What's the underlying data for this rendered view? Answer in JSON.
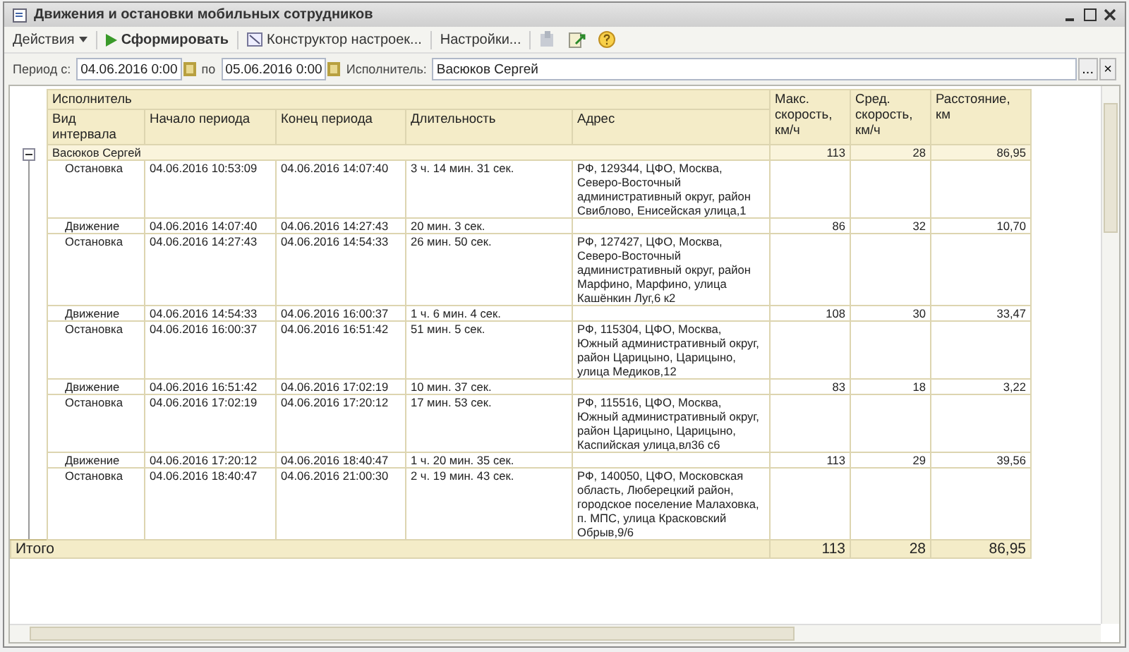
{
  "window": {
    "title": "Движения и остановки мобильных сотрудников"
  },
  "toolbar": [
    {
      "kind": "menu",
      "label": "Действия"
    },
    {
      "kind": "run",
      "label": "Сформировать"
    },
    {
      "kind": "designer",
      "label": "Конструктор настроек..."
    },
    {
      "kind": "plain",
      "label": "Настройки..."
    },
    {
      "kind": "icon-disabled"
    },
    {
      "kind": "icon-export"
    },
    {
      "kind": "icon-help"
    }
  ],
  "filters": {
    "period_label": "Период с:",
    "period_from": "04.06.2016  0:00",
    "to_label": "по",
    "period_to": "05.06.2016  0:00",
    "executor_label": "Исполнитель:",
    "executor": "Васюков Сергей",
    "choose_button": "...",
    "clear_button": "×"
  },
  "table": {
    "group_header": "Исполнитель",
    "columns": [
      "Вид интервала",
      "Начало периода",
      "Конец периода",
      "Длительность",
      "Адрес",
      "Макс. скорость, км/ч",
      "Сред. скорость, км/ч",
      "Расстояние, км"
    ],
    "groups": [
      {
        "name": "Васюков Сергей",
        "expanded": true,
        "max_speed": "113",
        "avg_speed": "28",
        "distance": "86,95",
        "rows": [
          {
            "type": "Остановка",
            "start": "04.06.2016 10:53:09",
            "end": "04.06.2016 14:07:40",
            "duration": "3 ч. 14 мин. 31 сек.",
            "address": "РФ, 129344, ЦФО, Москва, Северо-Восточный административный округ, район Свиблово, Енисейская улица,1"
          },
          {
            "type": "Движение",
            "start": "04.06.2016 14:07:40",
            "end": "04.06.2016 14:27:43",
            "duration": "20 мин. 3 сек.",
            "max_speed": "86",
            "avg_speed": "32",
            "distance": "10,70"
          },
          {
            "type": "Остановка",
            "start": "04.06.2016 14:27:43",
            "end": "04.06.2016 14:54:33",
            "duration": "26 мин. 50 сек.",
            "address": "РФ, 127427, ЦФО, Москва, Северо-Восточный административный округ, район Марфино, Марфино, улица Кашёнкин Луг,6 к2"
          },
          {
            "type": "Движение",
            "start": "04.06.2016 14:54:33",
            "end": "04.06.2016 16:00:37",
            "duration": "1 ч. 6 мин. 4 сек.",
            "max_speed": "108",
            "avg_speed": "30",
            "distance": "33,47"
          },
          {
            "type": "Остановка",
            "start": "04.06.2016 16:00:37",
            "end": "04.06.2016 16:51:42",
            "duration": "51 мин. 5 сек.",
            "address": "РФ, 115304, ЦФО, Москва, Южный административный округ, район Царицыно, Царицыно, улица Медиков,12"
          },
          {
            "type": "Движение",
            "start": "04.06.2016 16:51:42",
            "end": "04.06.2016 17:02:19",
            "duration": "10 мин. 37 сек.",
            "max_speed": "83",
            "avg_speed": "18",
            "distance": "3,22"
          },
          {
            "type": "Остановка",
            "start": "04.06.2016 17:02:19",
            "end": "04.06.2016 17:20:12",
            "duration": "17 мин. 53 сек.",
            "address": "РФ, 115516, ЦФО, Москва, Южный административный округ, район Царицыно, Царицыно, Каспийская улица,вл36 с6"
          },
          {
            "type": "Движение",
            "start": "04.06.2016 17:20:12",
            "end": "04.06.2016 18:40:47",
            "duration": "1 ч. 20 мин. 35 сек.",
            "max_speed": "113",
            "avg_speed": "29",
            "distance": "39,56"
          },
          {
            "type": "Остановка",
            "start": "04.06.2016 18:40:47",
            "end": "04.06.2016 21:00:30",
            "duration": "2 ч. 19 мин. 43 сек.",
            "address": "РФ, 140050, ЦФО, Московская область, Люберецкий район, городское поселение Малаховка, п. МПС, улица Красковский Обрыв,9/6"
          }
        ]
      }
    ],
    "total": {
      "label": "Итого",
      "max_speed": "113",
      "avg_speed": "28",
      "distance": "86,95"
    }
  }
}
